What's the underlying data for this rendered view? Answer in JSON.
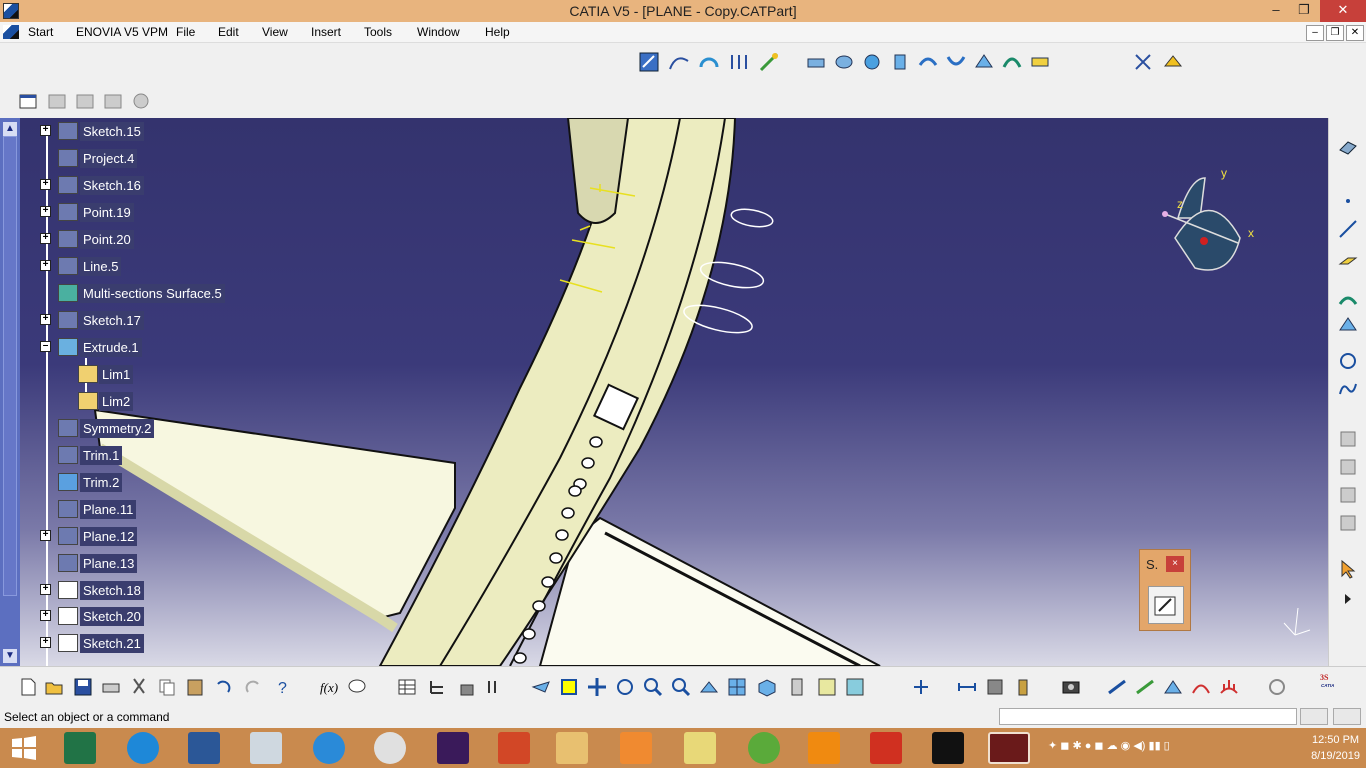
{
  "window": {
    "title": "CATIA V5 - [PLANE - Copy.CATPart]",
    "minimize": "–",
    "restore": "❐",
    "close": "✕"
  },
  "menu": {
    "items": [
      "Start",
      "ENOVIA V5 VPM",
      "File",
      "Edit",
      "View",
      "Insert",
      "Tools",
      "Window",
      "Help"
    ]
  },
  "tree": {
    "items": [
      {
        "label": "Sketch.15",
        "expand": "+"
      },
      {
        "label": "Project.4",
        "expand": ""
      },
      {
        "label": "Sketch.16",
        "expand": "+"
      },
      {
        "label": "Point.19",
        "expand": "+"
      },
      {
        "label": "Point.20",
        "expand": "+"
      },
      {
        "label": "Line.5",
        "expand": "+"
      },
      {
        "label": "Multi-sections Surface.5",
        "expand": ""
      },
      {
        "label": "Sketch.17",
        "expand": "+"
      },
      {
        "label": "Extrude.1",
        "expand": "–"
      },
      {
        "label": "Lim1",
        "expand": ""
      },
      {
        "label": "Lim2",
        "expand": ""
      },
      {
        "label": "Symmetry.2",
        "expand": ""
      },
      {
        "label": "Trim.1",
        "expand": ""
      },
      {
        "label": "Trim.2",
        "expand": ""
      },
      {
        "label": "Plane.11",
        "expand": ""
      },
      {
        "label": "Plane.12",
        "expand": "+"
      },
      {
        "label": "Plane.13",
        "expand": ""
      },
      {
        "label": "Sketch.18",
        "expand": "+"
      },
      {
        "label": "Sketch.20",
        "expand": "+"
      },
      {
        "label": "Sketch.21",
        "expand": "+"
      }
    ]
  },
  "compass": {
    "x": "x",
    "y": "y",
    "z": "z"
  },
  "sketch_panel": {
    "title": "S.",
    "close": "×"
  },
  "status": {
    "message": "Select an object or a command"
  },
  "taskbar": {
    "time": "12:50 PM",
    "date": "8/19/2019"
  },
  "colors": {
    "titlebar": "#e8b47e",
    "taskbar": "#c98a4e",
    "viewport_top": "#34336e",
    "model": "#ececc0"
  }
}
